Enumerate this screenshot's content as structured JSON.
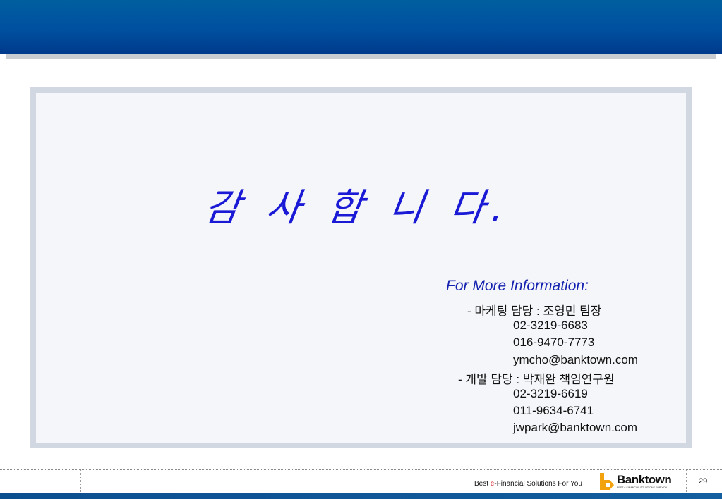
{
  "slide": {
    "thanks": "감 사 합 니 다.",
    "info_title": "For More Information:",
    "contacts": [
      "- 마케팅 담당 : 조영민 팀장",
      "02-3219-6683",
      "016-9470-7773",
      "ymcho@banktown.com",
      "- 개발 담당 : 박재완 책임연구원",
      "02-3219-6619",
      "011-9634-6741",
      "jwpark@banktown.com"
    ]
  },
  "footer": {
    "slogan_prefix": "Best ",
    "slogan_accent": "e",
    "slogan_suffix": "-Financial Solutions For You",
    "logo_text": "Banktown",
    "logo_tagline": "BEST e-FINANCIAL SOLUTIONS FOR YOU",
    "page_number": "29"
  },
  "colors": {
    "header": "#0050a0",
    "title_text": "#1a1ad6",
    "logo_accent": "#f2a20c"
  }
}
